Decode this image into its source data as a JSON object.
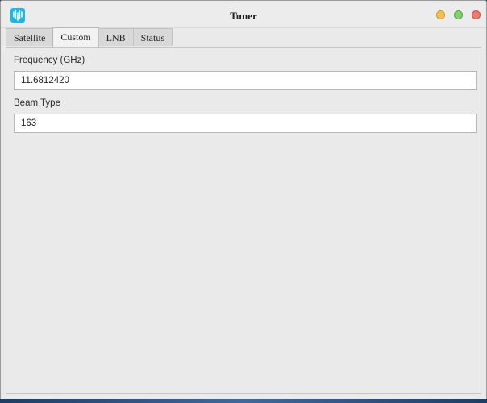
{
  "window": {
    "title": "Tuner",
    "app_icon": "tuner-app-icon",
    "controls": [
      "minimize-button",
      "maximize-button",
      "close-button"
    ]
  },
  "tabs": [
    {
      "label": "Satellite",
      "active": false
    },
    {
      "label": "Custom",
      "active": true
    },
    {
      "label": "LNB",
      "active": false
    },
    {
      "label": "Status",
      "active": false
    }
  ],
  "form": {
    "frequency": {
      "label": "Frequency (GHz)",
      "value": "11.6812420"
    },
    "beam_type": {
      "label": "Beam Type",
      "value": "163"
    }
  },
  "colors": {
    "app_icon": "#1ab7e8",
    "minimize": "#f4bf4f",
    "maximize": "#7ed36b",
    "close": "#ee7a6c"
  }
}
